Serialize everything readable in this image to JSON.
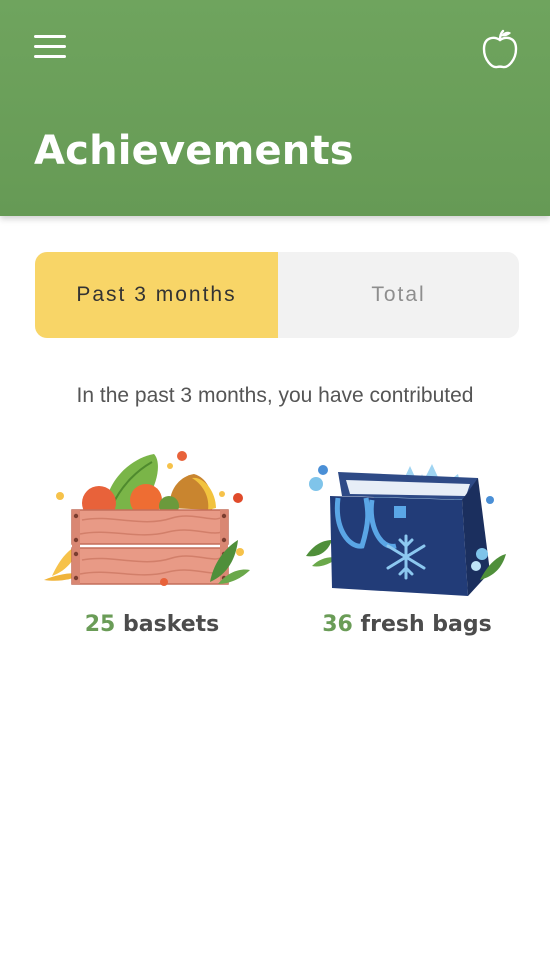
{
  "header": {
    "title": "Achievements",
    "menu_icon": "hamburger-menu-icon",
    "logo_icon": "apple-icon",
    "color": "#6a9f59"
  },
  "tabs": [
    {
      "label": "Past 3 months",
      "active": true
    },
    {
      "label": "Total",
      "active": false
    }
  ],
  "summary": {
    "intro": "In the past 3 months, you have contributed"
  },
  "stats": [
    {
      "number": "25",
      "label": "baskets",
      "icon": "produce-crate-illustration"
    },
    {
      "number": "36",
      "label": "fresh bags",
      "icon": "freezer-bag-illustration"
    }
  ],
  "colors": {
    "accent_green": "#6a9c57",
    "active_tab": "#f8d567",
    "inactive_tab": "#f2f2f2"
  }
}
